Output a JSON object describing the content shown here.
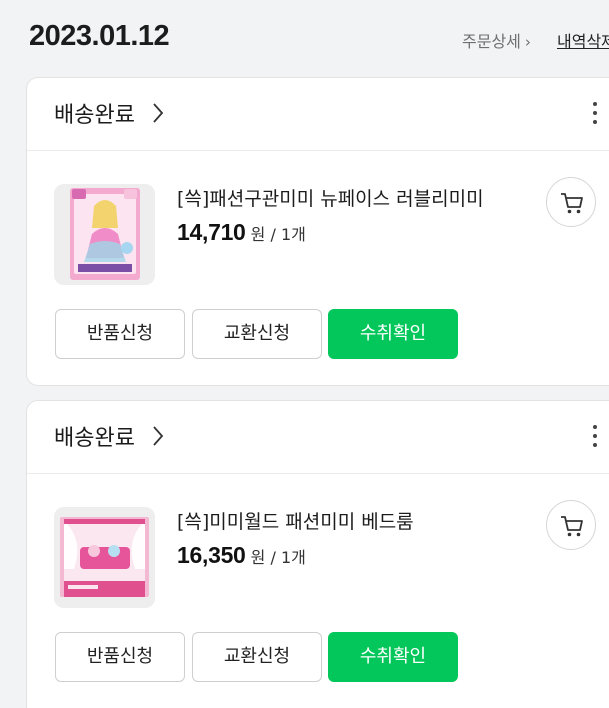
{
  "order": {
    "date": "2023.01.12",
    "detail_link": "주문상세",
    "history_link": "내역삭제"
  },
  "icons": {
    "chevron": "chevron-right-icon",
    "more": "more-vertical-icon",
    "cart": "cart-icon"
  },
  "colors": {
    "confirm_button": "#03c75a",
    "page_background": "#f2f3f5"
  },
  "orders": [
    {
      "status": "배송완료",
      "product_name": "[쓱]패션구관미미 뉴페이스 러블리미미",
      "price": "14,710",
      "price_unit": "원",
      "quantity": "/ 1개",
      "buttons": {
        "return": "반품신청",
        "exchange": "교환신청",
        "confirm": "수취확인"
      }
    },
    {
      "status": "배송완료",
      "product_name": "[쓱]미미월드 패션미미 베드룸",
      "price": "16,350",
      "price_unit": "원",
      "quantity": "/ 1개",
      "buttons": {
        "return": "반품신청",
        "exchange": "교환신청",
        "confirm": "수취확인"
      }
    }
  ]
}
